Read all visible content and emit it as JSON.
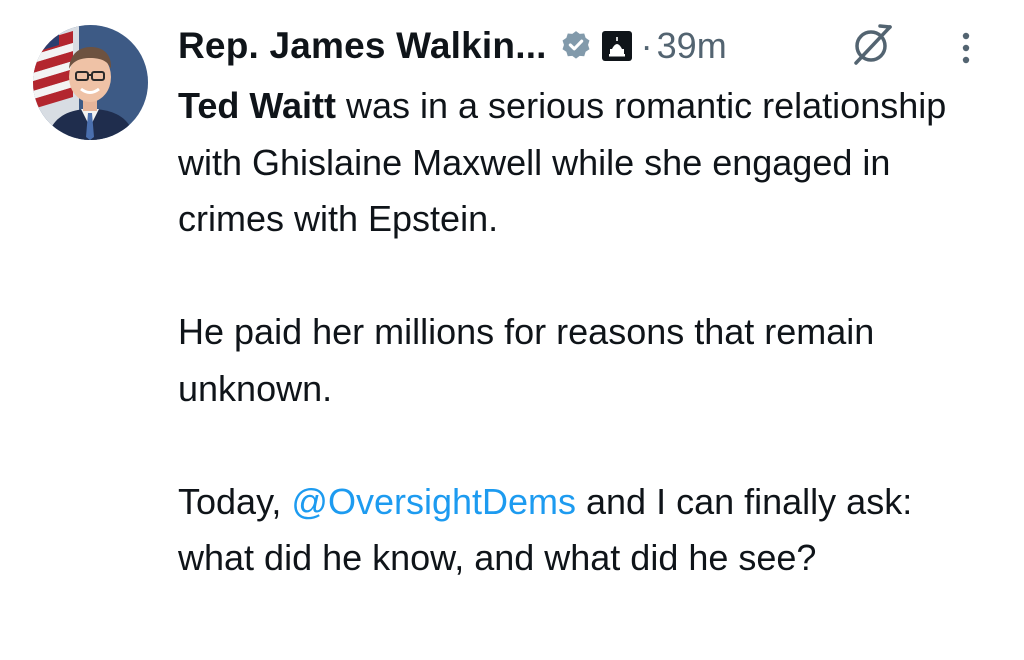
{
  "author": {
    "display_name": "Rep. James Walkin...",
    "verified_icon": "verified-badge-icon",
    "affiliation_icon": "capitol-building-icon",
    "separator": "·",
    "timestamp": "39m"
  },
  "actions": {
    "grok_icon": "grok-icon",
    "more_icon": "more-vertical-icon"
  },
  "tweet": {
    "p1": {
      "bold_name": "Ted Waitt",
      "text_a": " was in a serious romantic relationship with Ghislaine Maxwell while she engaged in crimes with Epstein."
    },
    "p2": {
      "text": "He paid her millions for reasons that remain unknown."
    },
    "p3": {
      "text_before": "Today, ",
      "mention": "@OversightDems",
      "text_after": " and I can finally ask: what did he know, and what did he see?"
    }
  },
  "colors": {
    "text": "#0f1419",
    "secondary": "#536471",
    "link": "#1d9bf0",
    "verified_badge": "#829aab"
  }
}
